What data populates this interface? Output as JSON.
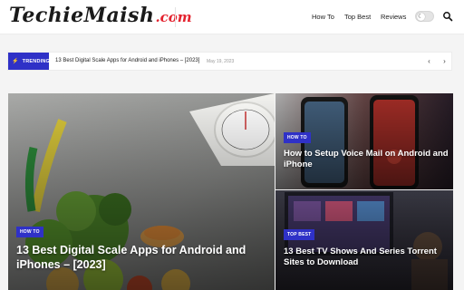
{
  "header": {
    "logo_main": "TechieMaish",
    "logo_suffix": ".com",
    "nav": [
      {
        "label": "How To"
      },
      {
        "label": "Top Best"
      },
      {
        "label": "Reviews"
      }
    ],
    "icons": {
      "toggle": "moon-toggle-icon",
      "search": "search-icon"
    }
  },
  "trending": {
    "label": "TRENDING",
    "title": "13 Best Digital Scale Apps for Android and iPhones – [2023]",
    "date": "May 19, 2023",
    "prev": "‹",
    "next": "›"
  },
  "cards": [
    {
      "category": "HOW TO",
      "title": "13 Best Digital Scale Apps for Android and iPhones – [2023]"
    },
    {
      "category": "HOW TO",
      "title": "How to Setup Voice Mail on Android and iPhone"
    },
    {
      "category": "TOP BEST",
      "title": "13 Best TV Shows And Series Torrent Sites to Download"
    }
  ],
  "colors": {
    "accent": "#2f31c7",
    "brand_red": "#e4232f"
  }
}
